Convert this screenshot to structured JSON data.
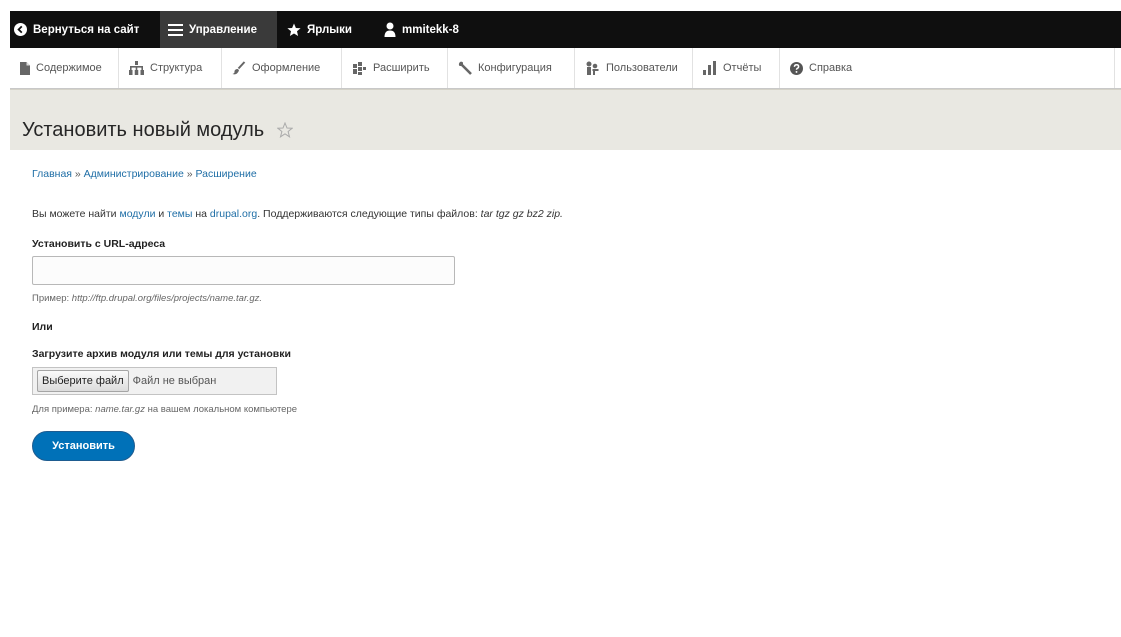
{
  "toolbar": {
    "back_label": "Вернуться на сайт",
    "manage_label": "Управление",
    "shortcuts_label": "Ярлыки",
    "user_label": "mmitekk-8"
  },
  "tray": {
    "items": [
      {
        "label": "Содержимое",
        "icon": "file-icon"
      },
      {
        "label": "Структура",
        "icon": "structure-icon"
      },
      {
        "label": "Оформление",
        "icon": "paintbrush-icon"
      },
      {
        "label": "Расширить",
        "icon": "puzzle-icon"
      },
      {
        "label": "Конфигурация",
        "icon": "wrench-icon"
      },
      {
        "label": "Пользователи",
        "icon": "people-icon"
      },
      {
        "label": "Отчёты",
        "icon": "bar-chart-icon"
      },
      {
        "label": "Справка",
        "icon": "help-icon"
      }
    ]
  },
  "page": {
    "title": "Установить новый модуль"
  },
  "breadcrumb": {
    "home": "Главная",
    "admin": "Администрирование",
    "extend": "Расширение",
    "separator": "»"
  },
  "intro": {
    "prefix": "Вы можете найти ",
    "modules_link": "модули",
    "and": " и ",
    "themes_link": "темы",
    "on": " на ",
    "drupal_link": "drupal.org",
    "suffix": ". Поддерживаются следующие типы файлов: ",
    "types": "tar tgz gz bz2 zip."
  },
  "form": {
    "url_label": "Установить с URL-адреса",
    "url_value": "",
    "url_hint_prefix": "Пример: ",
    "url_hint_example": "http://ftp.drupal.org/files/projects/name.tar.gz.",
    "or_label": "Или",
    "upload_label": "Загрузите архив модуля или темы для установки",
    "file_button": "Выберите файл",
    "file_status": "Файл не выбран",
    "upload_hint_prefix": "Для примера: ",
    "upload_hint_example": "name.tar.gz",
    "upload_hint_suffix": " на вашем локальном компьютере",
    "submit_label": "Установить"
  }
}
